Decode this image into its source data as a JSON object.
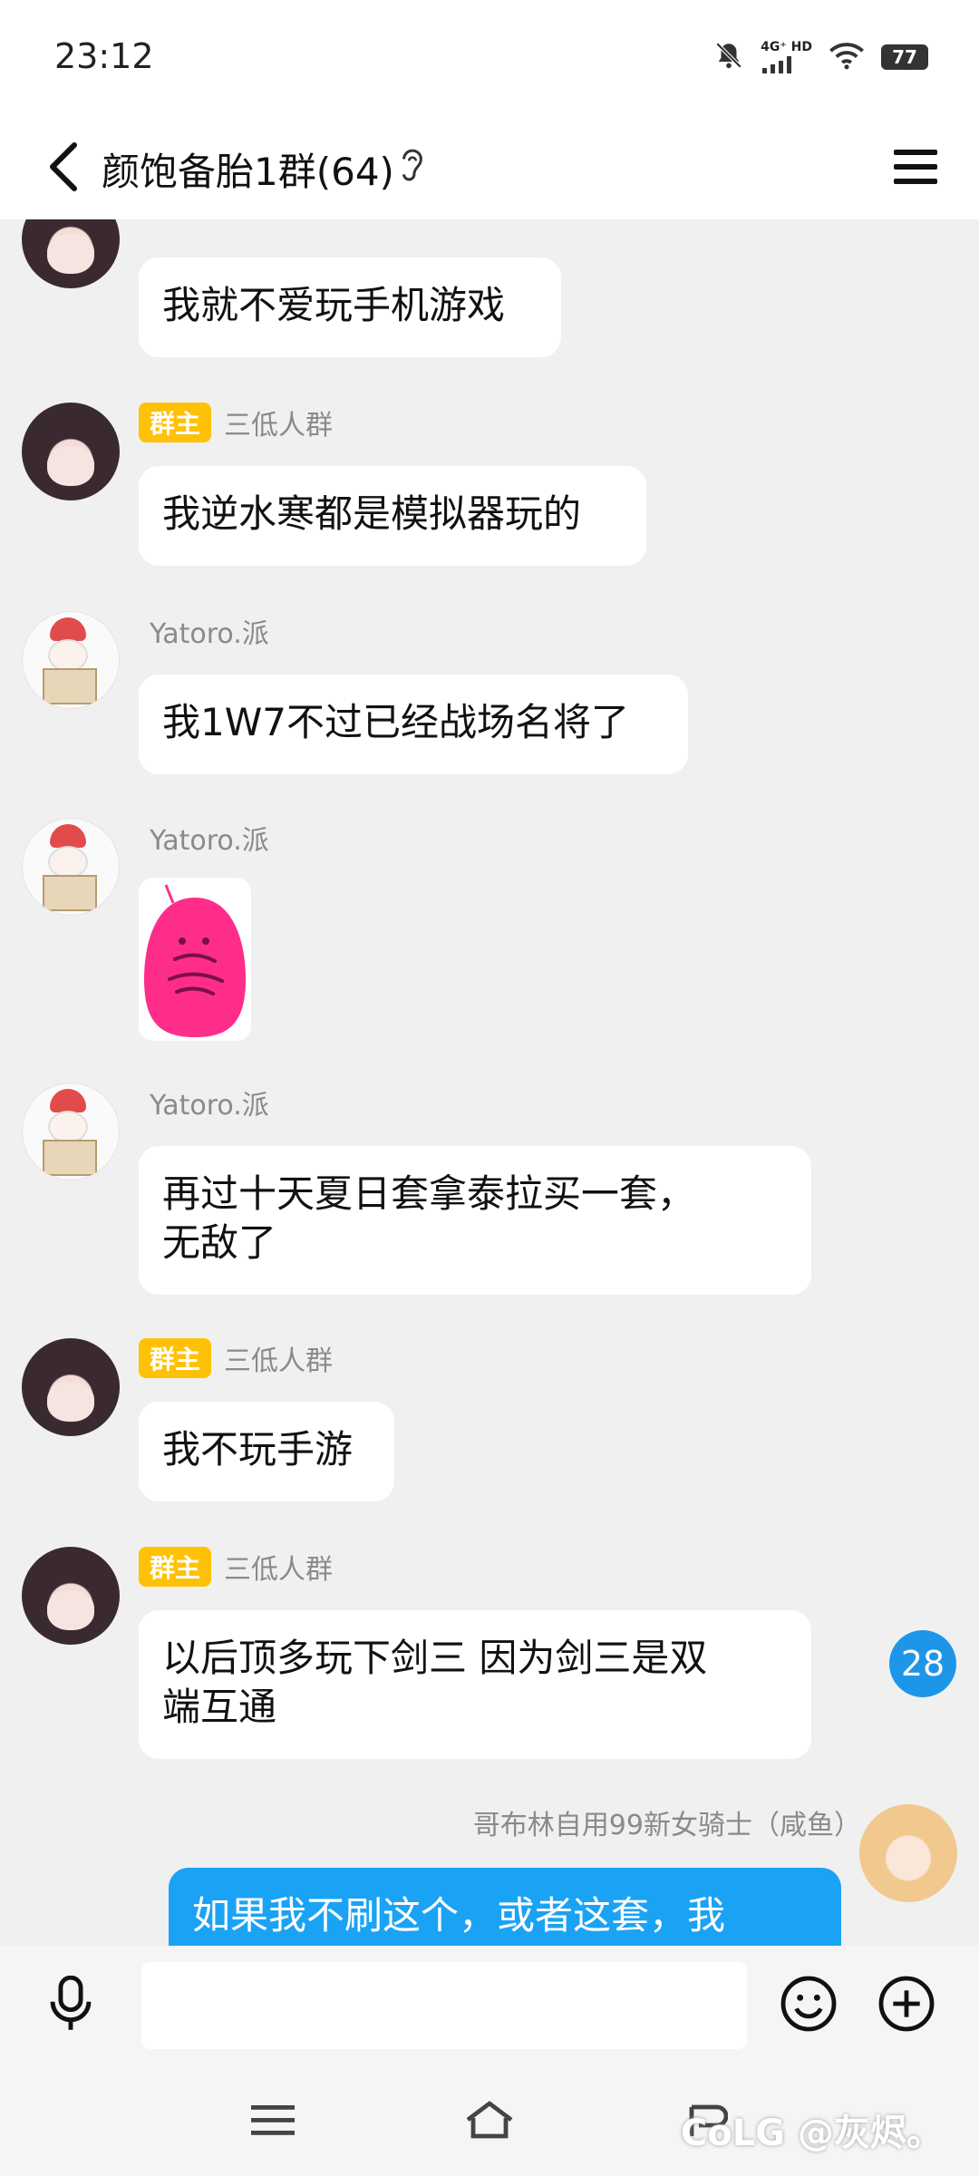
{
  "status_bar": {
    "time": "23:12",
    "signal_label": "4G⁺ HD",
    "battery": "77"
  },
  "header": {
    "title": "颜饱备胎1群(64)"
  },
  "messages": [
    {
      "sender": "",
      "text": "我就不爱玩手机游戏"
    },
    {
      "badge": "群主",
      "sender": "三低人群",
      "text": "我逆水寒都是模拟器玩的"
    },
    {
      "sender": "Yatoro.派",
      "text": "我1W7不过已经战场名将了"
    },
    {
      "sender": "Yatoro.派",
      "text": ""
    },
    {
      "sender": "Yatoro.派",
      "text": "再过十天夏日套拿泰拉买一套，\n无敌了"
    },
    {
      "badge": "群主",
      "sender": "三低人群",
      "text": "我不玩手游"
    },
    {
      "badge": "群主",
      "sender": "三低人群",
      "text": "以后顶多玩下剑三 因为剑三是双\n端互通"
    },
    {
      "sender": "哥布林自用99新女骑士（咸鱼）",
      "text": "如果我不刷这个，或者这套，我"
    }
  ],
  "unread_count": "28",
  "input": {
    "placeholder": ""
  },
  "watermark": "CoLG @灰烬。",
  "colors": {
    "accent": "#1aa3f5",
    "badge": "#ffc107",
    "sticker": "#ff2d8a"
  }
}
